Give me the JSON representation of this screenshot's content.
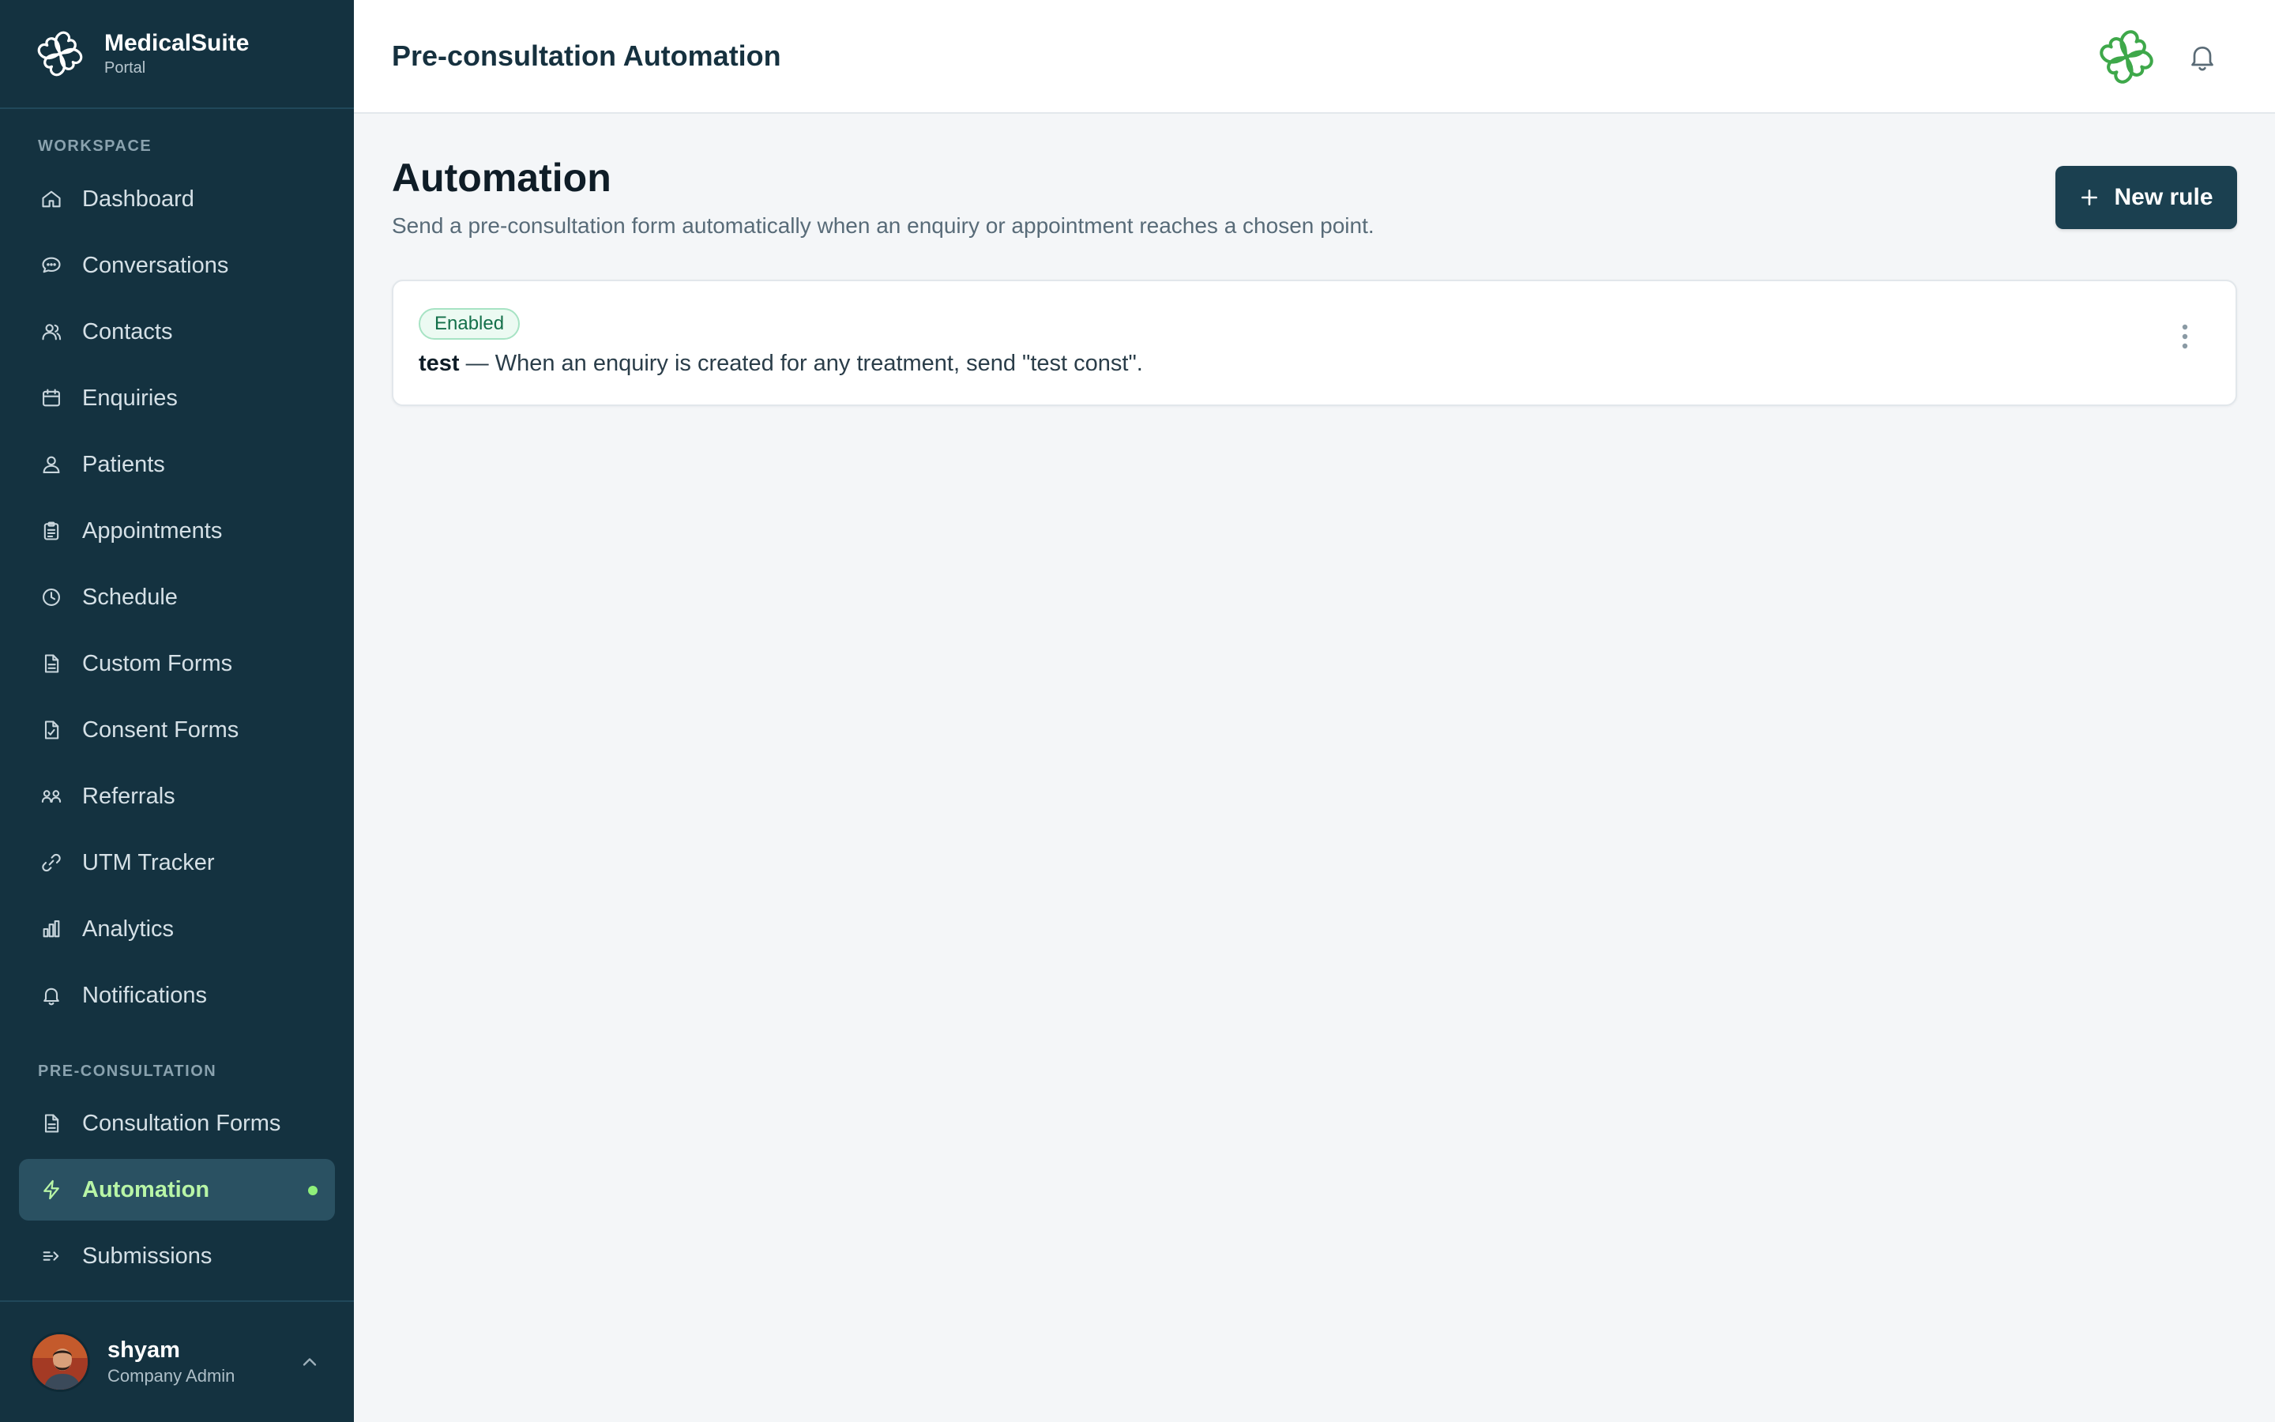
{
  "brand": {
    "name": "MedicalSuite",
    "subtitle": "Portal"
  },
  "sidebar": {
    "workspace_label": "WORKSPACE",
    "workspace_items": [
      {
        "label": "Dashboard",
        "icon": "home-icon"
      },
      {
        "label": "Conversations",
        "icon": "chat-icon"
      },
      {
        "label": "Contacts",
        "icon": "contacts-icon"
      },
      {
        "label": "Enquiries",
        "icon": "calendar-icon"
      },
      {
        "label": "Patients",
        "icon": "user-icon"
      },
      {
        "label": "Appointments",
        "icon": "clipboard-icon"
      },
      {
        "label": "Schedule",
        "icon": "clock-icon"
      },
      {
        "label": "Custom Forms",
        "icon": "document-icon"
      },
      {
        "label": "Consent Forms",
        "icon": "signed-document-icon"
      },
      {
        "label": "Referrals",
        "icon": "referrals-icon"
      },
      {
        "label": "UTM Tracker",
        "icon": "link-icon"
      },
      {
        "label": "Analytics",
        "icon": "bar-chart-icon"
      },
      {
        "label": "Notifications",
        "icon": "bell-icon"
      }
    ],
    "preconsult_label": "PRE-CONSULTATION",
    "preconsult_items": [
      {
        "label": "Consultation Forms",
        "icon": "document-icon"
      },
      {
        "label": "Automation",
        "icon": "lightning-icon",
        "active": true
      },
      {
        "label": "Submissions",
        "icon": "submit-icon"
      }
    ]
  },
  "user": {
    "name": "shyam",
    "role": "Company Admin"
  },
  "header": {
    "title": "Pre-consultation Automation"
  },
  "main": {
    "heading": "Automation",
    "description": "Send a pre-consultation form automatically when an enquiry or appointment reaches a chosen point.",
    "new_rule_label": "New rule"
  },
  "rules": [
    {
      "status": "Enabled",
      "name": "test",
      "description": " — When an enquiry is created for any treatment, send \"test const\"."
    }
  ],
  "colors": {
    "sidebar_bg": "#143240",
    "active_bg": "#2a5162",
    "active_text": "#b8f5a6",
    "primary_button": "#1b4050",
    "enabled_badge": "#14704a",
    "logo_green": "#3ea84a"
  }
}
